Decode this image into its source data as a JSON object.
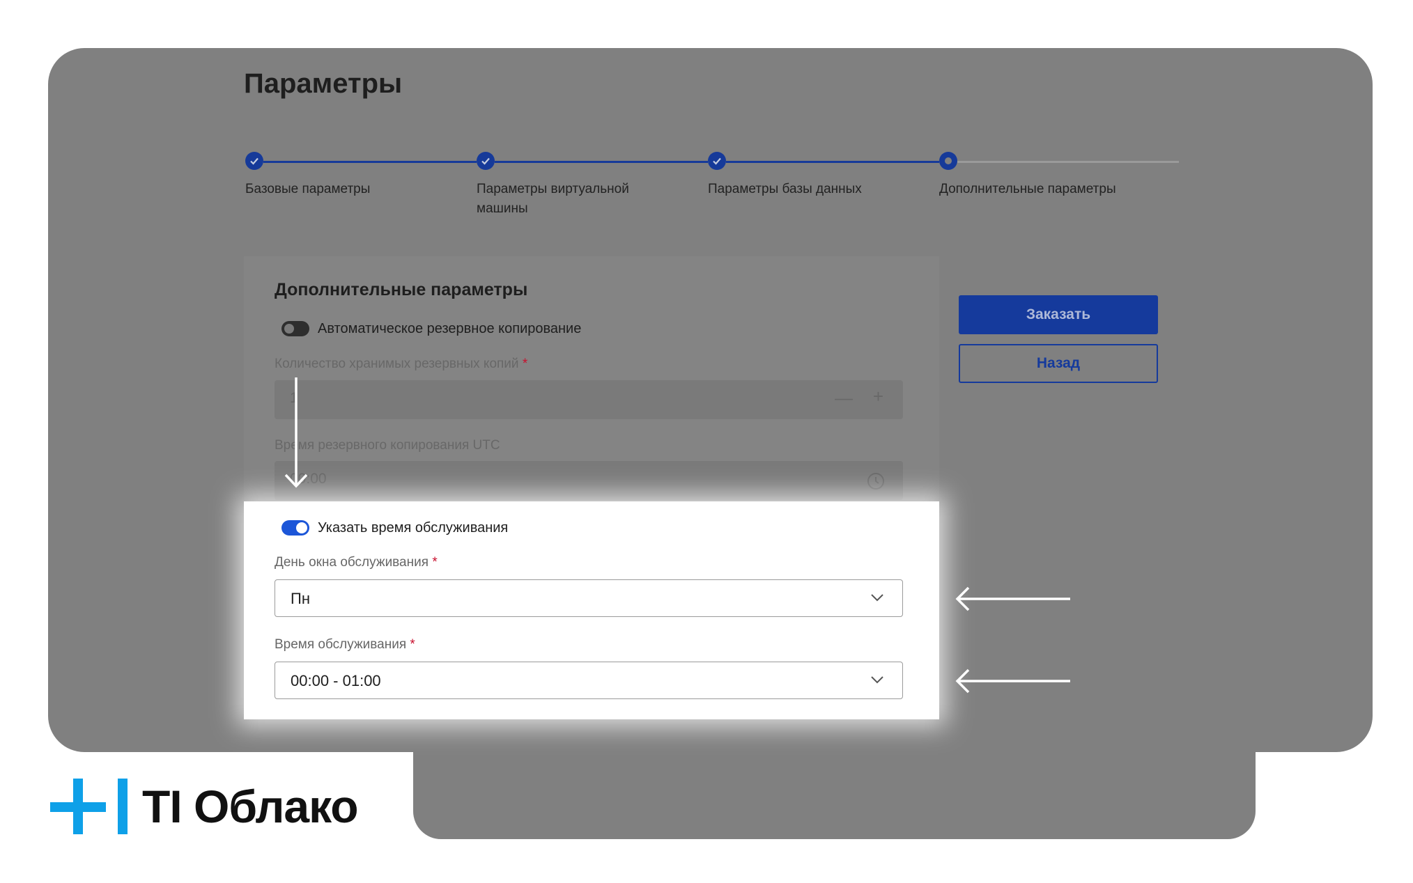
{
  "page": {
    "title": "Параметры"
  },
  "stepper": {
    "steps": [
      {
        "label": "Базовые параметры",
        "state": "done"
      },
      {
        "label": "Параметры виртуальной машины",
        "state": "done"
      },
      {
        "label": "Параметры базы данных",
        "state": "done"
      },
      {
        "label": "Дополнительные параметры",
        "state": "current"
      }
    ]
  },
  "card": {
    "title": "Дополнительные параметры",
    "backup_toggle": {
      "label": "Автоматическое резервное копирование",
      "on": false
    },
    "backup_count": {
      "label": "Количество хранимых резервных копий",
      "required_mark": "*",
      "value": "1"
    },
    "backup_time": {
      "label": "Время резервного копирования UTC",
      "value": "00:00"
    },
    "maintenance_toggle": {
      "label": "Указать время обслуживания",
      "on": true
    },
    "maintenance_day": {
      "label": "День окна обслуживания",
      "required_mark": "*",
      "value": "Пн"
    },
    "maintenance_time": {
      "label": "Время обслуживания",
      "required_mark": "*",
      "value": "00:00 - 01:00"
    }
  },
  "actions": {
    "order_label": "Заказать",
    "back_label": "Назад"
  },
  "brand": {
    "name": "TI Облако",
    "accent_color": "#0ea0e8",
    "primary_color": "#153a9c"
  }
}
